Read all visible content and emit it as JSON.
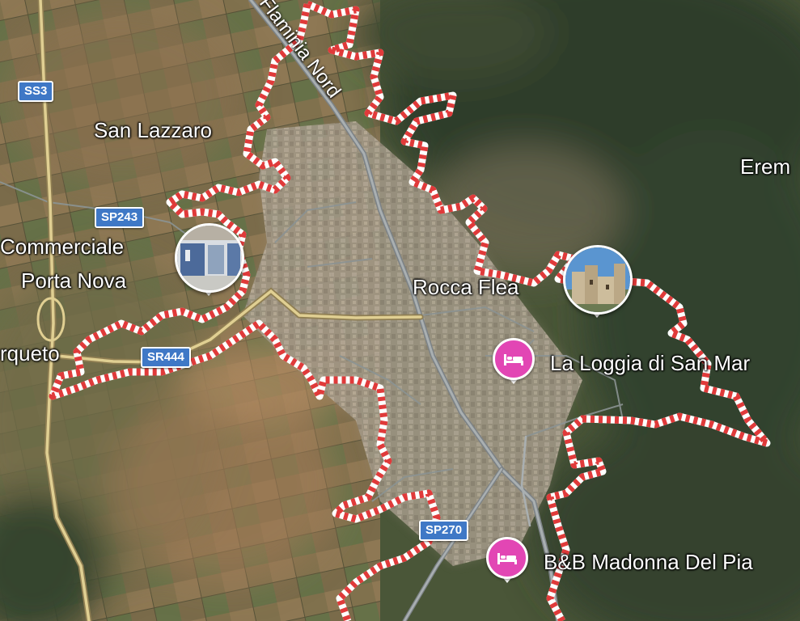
{
  "map": {
    "roads": {
      "flaminia": "Via Flaminia Nord",
      "ss3": "SS3",
      "sp243": "SP243",
      "sr444": "SR444",
      "sp270": "SP270"
    },
    "places": {
      "san_lazzaro": "San Lazzaro",
      "commerciale_line1": "Commerciale",
      "commerciale_line2": "Porta Nova",
      "rocca_flea": "Rocca Flea",
      "erem": "Erem",
      "rqueto": "rqueto"
    },
    "pois": {
      "loggia": "La Loggia di San Mar",
      "madonna": "B&B Madonna Del Pia"
    },
    "icons": {
      "lodging": "bed-icon",
      "photo_pin": "photo-pin"
    },
    "colors": {
      "boundary_red": "#e03a3a",
      "boundary_white": "#ffffff",
      "shield_blue": "#3f78c6",
      "poi_pink": "#e246b4",
      "major_road": "#d7c48a",
      "minor_road": "#9aa2a4"
    }
  }
}
